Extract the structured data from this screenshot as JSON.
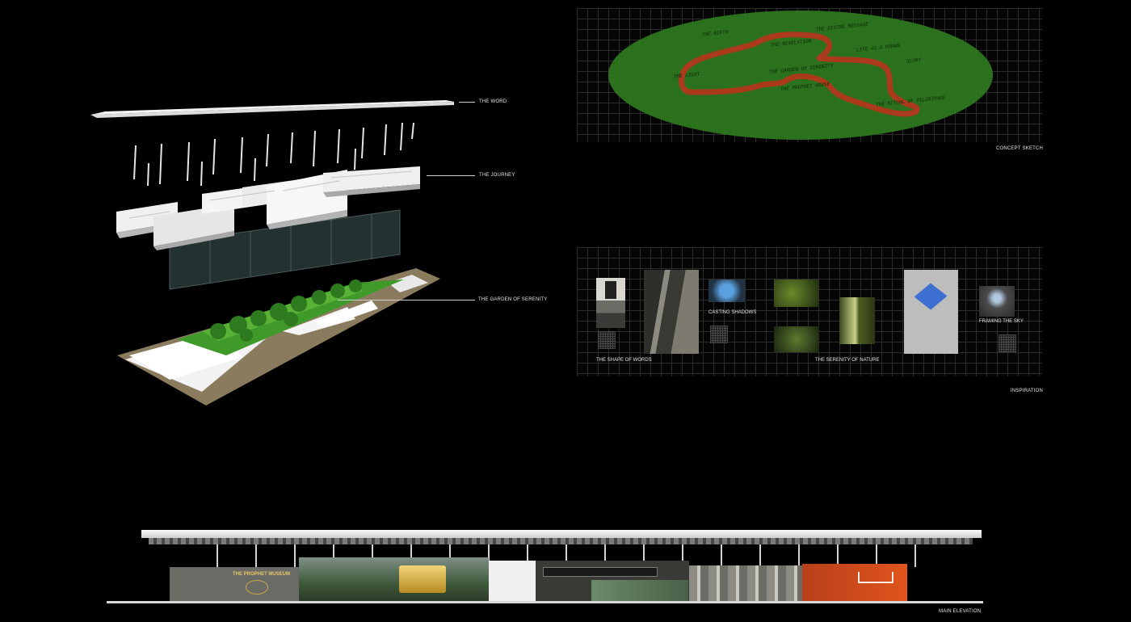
{
  "axonometric": {
    "labels": {
      "word": "THE WORD",
      "journey": "THE JOURNEY",
      "garden": "THE GARDEN OF SERENITY"
    }
  },
  "concept": {
    "caption": "CONCEPT SKETCH",
    "words": {
      "birth": "THE BIRTH",
      "divine": "THE DIVINE MESSAGE",
      "revelation": "THE REVELATION",
      "life": "LIFE AS A HUMAN",
      "light": "THE LIGHT",
      "garden": "THE GARDEN OF SERENITY",
      "house": "THE PROPHET HOUSE",
      "ritual": "THE RITUAL OF PILGRIMAGE",
      "glory": "GLORY"
    }
  },
  "inspiration": {
    "caption": "INSPIRATION",
    "labels": {
      "shadows": "CASTING SHADOWS",
      "sky": "FRAMING THE SKY",
      "words": "THE SHAPE OF WORDS",
      "nature": "THE SERENITY OF NATURE"
    }
  },
  "elevation": {
    "caption": "MAIN ELEVATION",
    "sign": "THE PROPHET MUSEUM"
  },
  "colors": {
    "sketch_oval": "#2f7a1f",
    "sketch_line": "#b8341c",
    "garden_green": "#3f9a2a",
    "orange_volume": "#e0541c",
    "gold_volume": "#d7a93a"
  }
}
